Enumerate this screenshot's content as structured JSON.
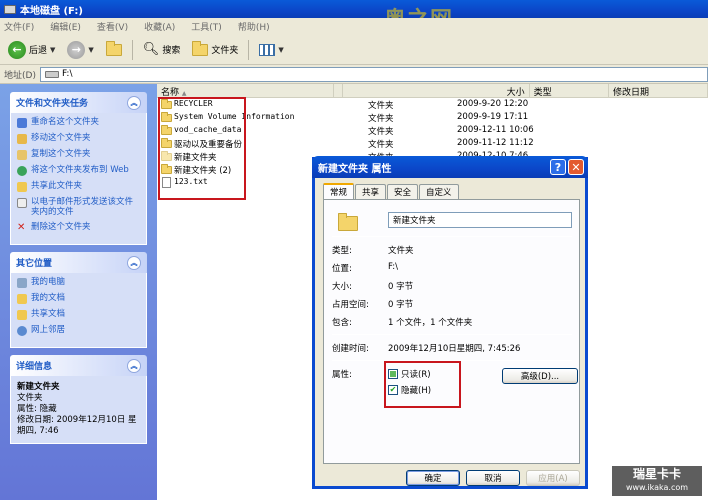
{
  "window": {
    "title": "本地磁盘 (F:)",
    "watermark": "奥之网"
  },
  "menu": [
    "文件(F)",
    "编辑(E)",
    "查看(V)",
    "收藏(A)",
    "工具(T)",
    "帮助(H)"
  ],
  "toolbar": {
    "back": "后退",
    "search": "搜索",
    "folders": "文件夹"
  },
  "address": {
    "label": "地址(D)",
    "value": "F:\\"
  },
  "file_tasks": {
    "title": "文件和文件夹任务",
    "items": [
      "重命名这个文件夹",
      "移动这个文件夹",
      "复制这个文件夹",
      "将这个文件夹发布到 Web",
      "共享此文件夹",
      "以电子邮件形式发送该文件夹内的文件",
      "删除这个文件夹"
    ]
  },
  "other_places": {
    "title": "其它位置",
    "items": [
      "我的电脑",
      "我的文档",
      "共享文档",
      "网上邻居"
    ]
  },
  "details": {
    "title": "详细信息",
    "name": "新建文件夹",
    "type": "文件夹",
    "attr": "属性: 隐藏",
    "modified": "修改日期: 2009年12月10日 星期四, 7:46"
  },
  "columns": {
    "name": "名称",
    "size": "大小",
    "type": "类型",
    "date": "修改日期"
  },
  "files": [
    {
      "name": "RECYCLER",
      "type": "文件夹",
      "date": "2009-9-20 12:20"
    },
    {
      "name": "System Volume Information",
      "type": "文件夹",
      "date": "2009-9-19 17:11"
    },
    {
      "name": "vod_cache_data",
      "type": "文件夹",
      "date": "2009-12-11 10:06"
    },
    {
      "name": "驱动以及重要备份",
      "type": "文件夹",
      "date": "2009-11-12 11:12"
    },
    {
      "name": "新建文件夹",
      "type": "文件夹",
      "date": "2009-12-10 7:46"
    },
    {
      "name": "新建文件夹 (2)",
      "type": "",
      "date": ""
    },
    {
      "name": "123.txt",
      "type": "",
      "date": ""
    }
  ],
  "dialog": {
    "title": "新建文件夹 属性",
    "tabs": [
      "常规",
      "共享",
      "安全",
      "自定义"
    ],
    "name": "新建文件夹",
    "type_label": "类型:",
    "type_value": "文件夹",
    "location_label": "位置:",
    "location_value": "F:\\",
    "size_label": "大小:",
    "size_value": "0 字节",
    "disk_label": "占用空间:",
    "disk_value": "0 字节",
    "contains_label": "包含:",
    "contains_value": "1 个文件，1 个文件夹",
    "created_label": "创建时间:",
    "created_value": "2009年12月10日星期四, 7:45:26",
    "attr_label": "属性:",
    "readonly": "只读(R)",
    "hidden": "隐藏(H)",
    "advanced": "高级(D)...",
    "ok": "确定",
    "cancel": "取消",
    "apply": "应用(A)"
  },
  "brand": {
    "line1": "瑞星卡卡",
    "line2": "www.ikaka.com"
  }
}
